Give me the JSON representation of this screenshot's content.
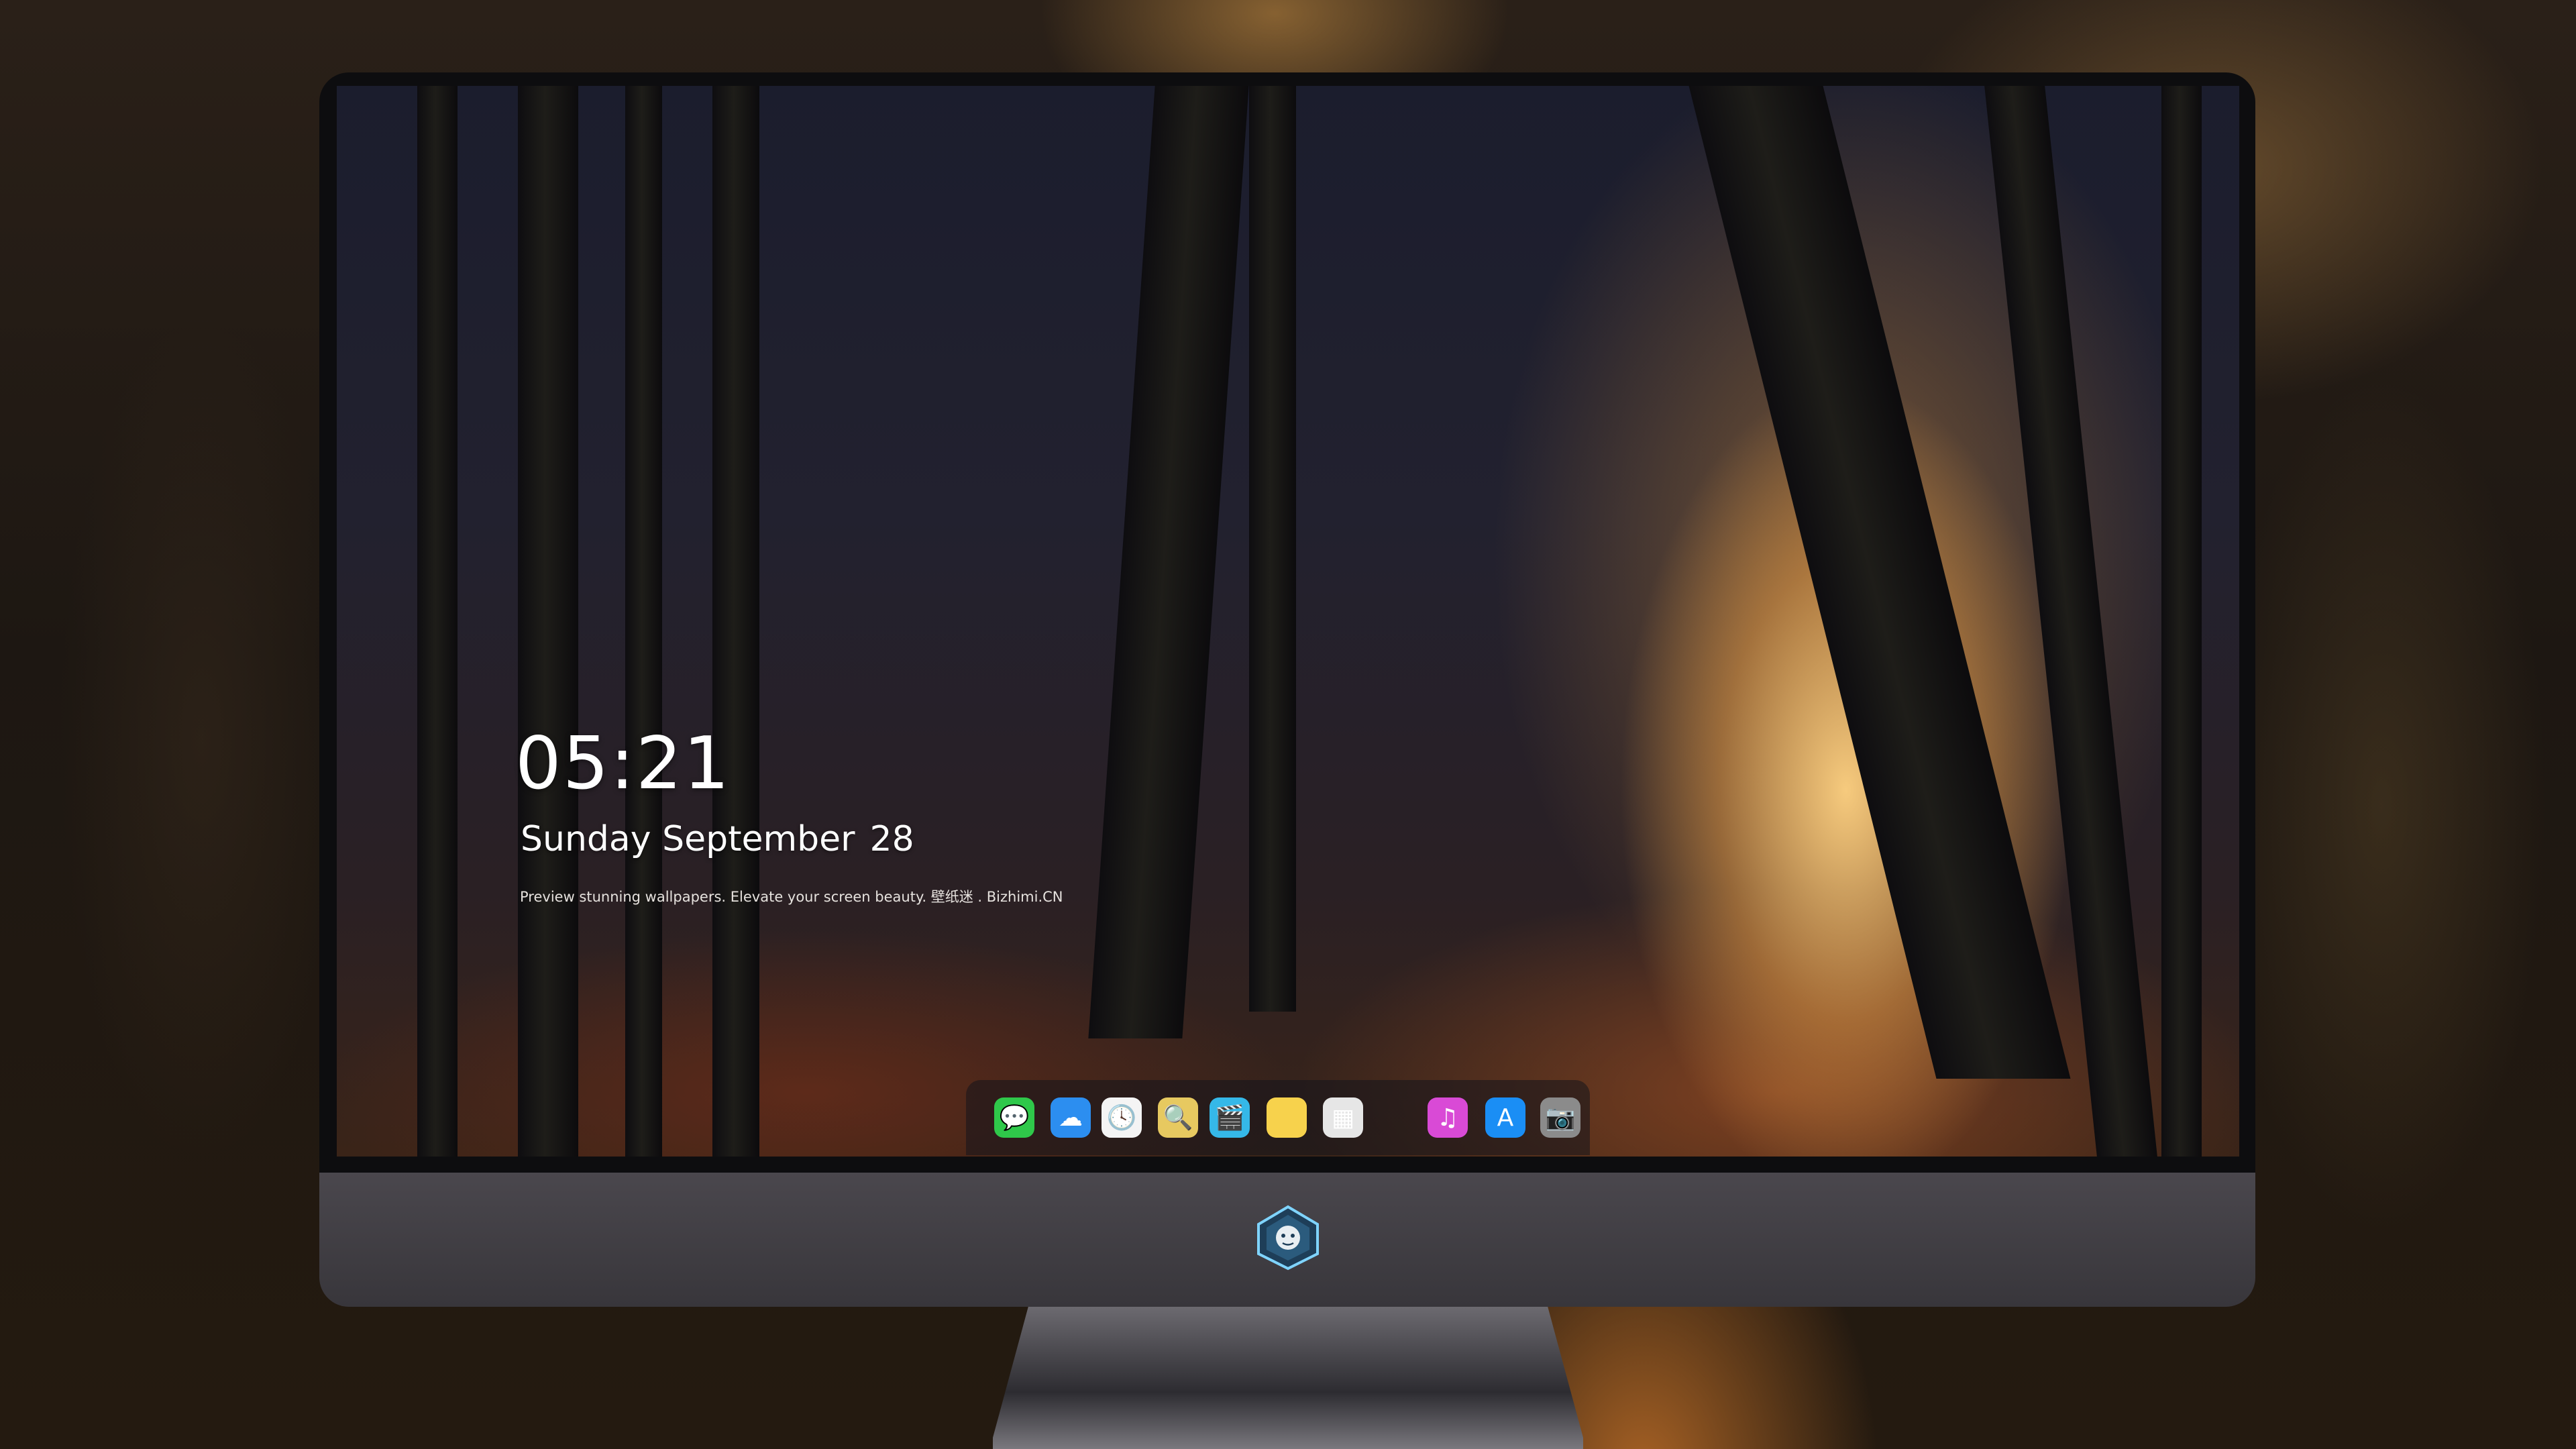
{
  "lockscreen": {
    "time": "05:21",
    "weekday_month": "Sunday September",
    "day": "28",
    "caption": "Preview stunning wallpapers. Elevate your screen beauty. 壁纸迷 . Bizhimi.CN"
  },
  "dock": {
    "apps": [
      {
        "name": "messages-icon",
        "glyph": "💬",
        "color": "#2fc84a"
      },
      {
        "name": "weather-icon",
        "glyph": "☁",
        "color": "#2c8ef0"
      },
      {
        "name": "clock-icon",
        "glyph": "🕓",
        "color": "#f4f4f4"
      },
      {
        "name": "preview-icon",
        "glyph": "🔍",
        "color": "#e7c960"
      },
      {
        "name": "clips-icon",
        "glyph": "🎬",
        "color": "#35b8e8"
      },
      {
        "name": "notes-icon",
        "glyph": "",
        "color": "#f7d24c"
      },
      {
        "name": "photo-booth-icon",
        "glyph": "▦",
        "color": "#e6e6e6"
      },
      {
        "name": "music-icon",
        "glyph": "♫",
        "color": "#d94ad6"
      },
      {
        "name": "app-store-icon",
        "glyph": "A",
        "color": "#1a8ef5"
      },
      {
        "name": "camera-icon",
        "glyph": "📷",
        "color": "#8b8b8b"
      }
    ]
  },
  "colors": {
    "bezel": "#0d0d0f",
    "chin": "#3f3d43",
    "clock_text": "#ffffff"
  }
}
